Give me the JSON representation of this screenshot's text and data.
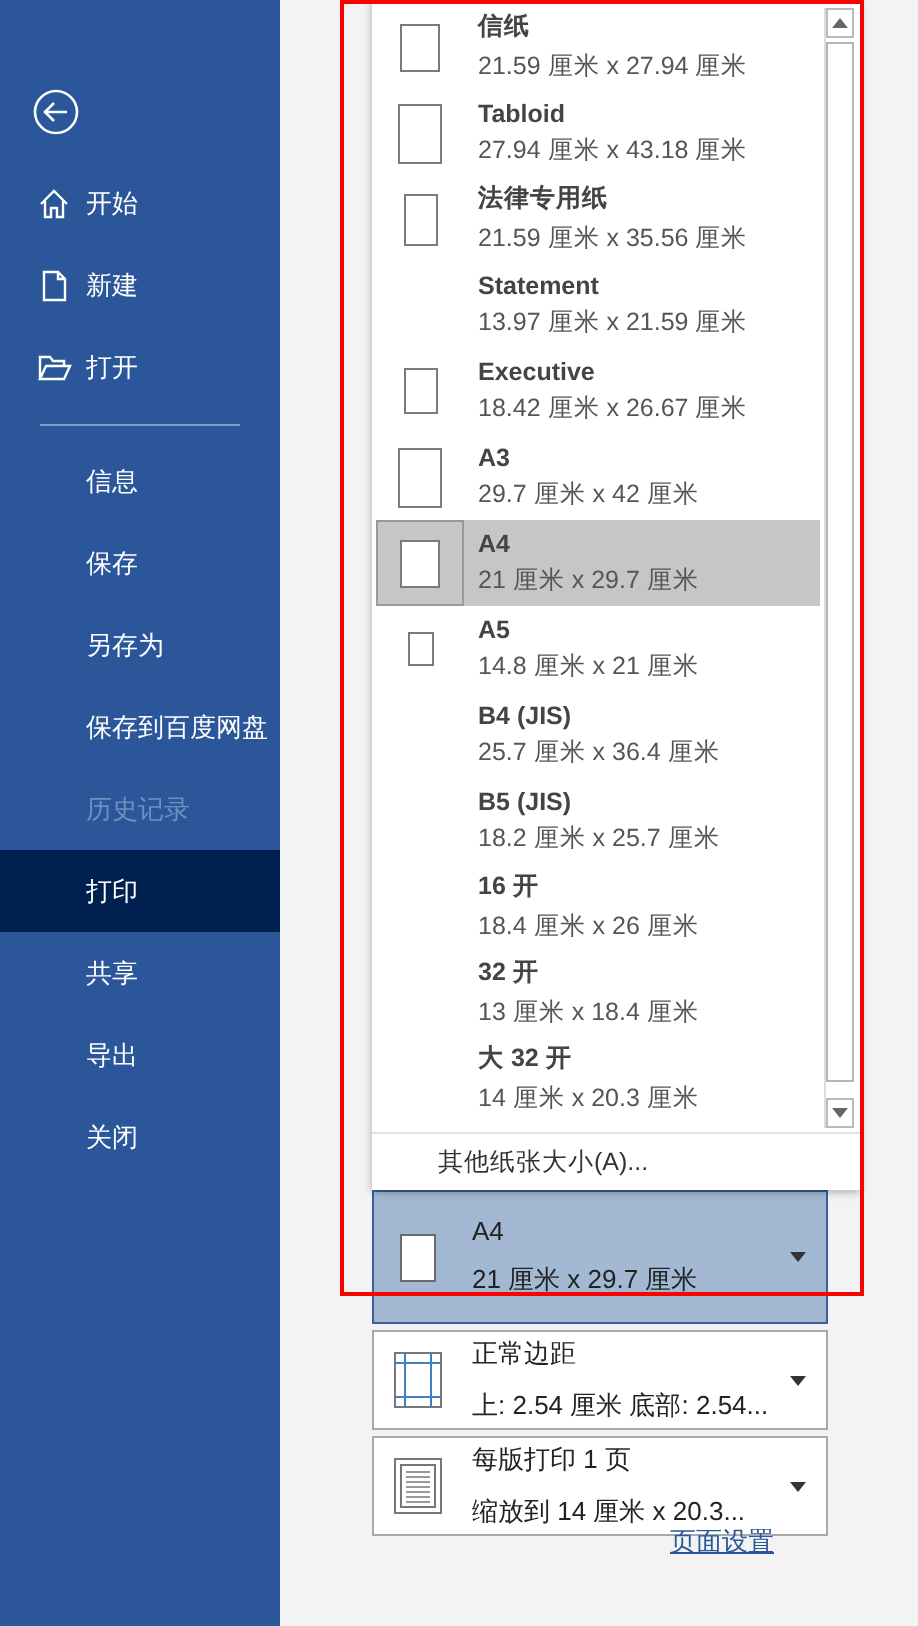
{
  "sidebar": {
    "items": [
      {
        "label": "开始",
        "selected": false,
        "disabled": false
      },
      {
        "label": "新建",
        "selected": false,
        "disabled": false
      },
      {
        "label": "打开",
        "selected": false,
        "disabled": false
      },
      {
        "kind": "divider"
      },
      {
        "label": "信息",
        "selected": false,
        "disabled": false
      },
      {
        "label": "保存",
        "selected": false,
        "disabled": false
      },
      {
        "label": "另存为",
        "selected": false,
        "disabled": false
      },
      {
        "label": "保存到百度网盘",
        "selected": false,
        "disabled": false
      },
      {
        "label": "历史记录",
        "selected": false,
        "disabled": true
      },
      {
        "label": "打印",
        "selected": true,
        "disabled": false
      },
      {
        "label": "共享",
        "selected": false,
        "disabled": false
      },
      {
        "label": "导出",
        "selected": false,
        "disabled": false
      },
      {
        "label": "关闭",
        "selected": false,
        "disabled": false
      }
    ]
  },
  "paper_list": {
    "items": [
      {
        "name": "信纸",
        "size": "21.59 厘米 x 27.94 厘米",
        "selected": false
      },
      {
        "name": "Tabloid",
        "size": "27.94 厘米 x 43.18 厘米",
        "selected": false
      },
      {
        "name": "法律专用纸",
        "size": "21.59 厘米 x 35.56 厘米",
        "selected": false
      },
      {
        "name": "Statement",
        "size": "13.97 厘米 x 21.59 厘米",
        "selected": false
      },
      {
        "name": "Executive",
        "size": "18.42 厘米 x 26.67 厘米",
        "selected": false
      },
      {
        "name": "A3",
        "size": "29.7 厘米 x 42 厘米",
        "selected": false
      },
      {
        "name": "A4",
        "size": "21 厘米 x 29.7 厘米",
        "selected": true
      },
      {
        "name": "A5",
        "size": "14.8 厘米 x 21 厘米",
        "selected": false
      },
      {
        "name": "B4 (JIS)",
        "size": "25.7 厘米 x 36.4 厘米",
        "selected": false
      },
      {
        "name": "B5 (JIS)",
        "size": "18.2 厘米 x 25.7 厘米",
        "selected": false
      },
      {
        "name": "16 开",
        "size": "18.4 厘米 x 26 厘米",
        "selected": false
      },
      {
        "name": "32 开",
        "size": "13 厘米 x 18.4 厘米",
        "selected": false
      },
      {
        "name": "大 32 开",
        "size": "14 厘米 x 20.3 厘米",
        "selected": false
      }
    ],
    "footer": "其他纸张大小(A)..."
  },
  "settings": [
    {
      "kind": "paper",
      "title": "A4",
      "subtitle": "21 厘米 x 29.7 厘米",
      "expanded": true
    },
    {
      "kind": "margins",
      "title": "正常边距",
      "subtitle": "上: 2.54 厘米 底部: 2.54...",
      "expanded": false
    },
    {
      "kind": "pages",
      "title": "每版打印 1 页",
      "subtitle": "缩放到 14 厘米 x 20.3...",
      "expanded": false
    }
  ],
  "page_setup_link": "页面设置"
}
